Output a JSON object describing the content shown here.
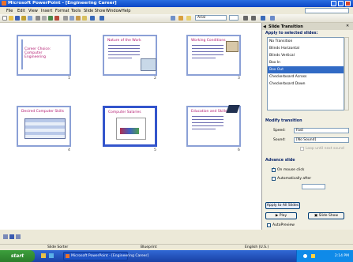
{
  "window": {
    "title": "Microsoft PowerPoint - [Engineering Career]"
  },
  "menu": [
    "File",
    "Edit",
    "View",
    "Insert",
    "Format",
    "Tools",
    "Slide Show",
    "Window",
    "Help"
  ],
  "toolbar": {
    "font_name": "Arial",
    "icons": [
      "new-icon",
      "open-icon",
      "save-icon",
      "permission-icon",
      "email-icon",
      "print-icon",
      "preview-icon",
      "spelling-icon",
      "research-icon",
      "cut-icon",
      "copy-icon",
      "paste-icon",
      "format-painter-icon",
      "undo-icon",
      "redo-icon"
    ]
  },
  "slides": [
    {
      "number": "1",
      "title": "Career Choice: Computer Engineering"
    },
    {
      "number": "2",
      "title": "Nature of the Work"
    },
    {
      "number": "3",
      "title": "Working Conditions"
    },
    {
      "number": "4",
      "title": "Desired Computer Skills"
    },
    {
      "number": "5",
      "title": "Computer Salaries"
    },
    {
      "number": "6",
      "title": "Education and Skills"
    }
  ],
  "task_pane": {
    "title": "Slide Transition",
    "apply_label": "Apply to selected slides:",
    "transitions": [
      "No Transition",
      "Blinds Horizontal",
      "Blinds Vertical",
      "Box In",
      "Box Out",
      "Checkerboard Across",
      "Checkerboard Down"
    ],
    "selected_transition": "Box Out",
    "modify_label": "Modify transition",
    "speed_label": "Speed:",
    "speed_value": "Fast",
    "sound_label": "Sound:",
    "sound_value": "[No Sound]",
    "loop_label": "Loop until next sound",
    "advance_label": "Advance slide",
    "on_click_label": "On mouse click",
    "auto_label": "Automatically after",
    "apply_all_button": "Apply to All Slides",
    "play_button": "Play",
    "slideshow_button": "Slide Show",
    "autopreview_label": "AutoPreview"
  },
  "statusbar": {
    "view": "Slide Sorter",
    "design": "Blueprint",
    "language": "English (U.S.)"
  },
  "taskbar": {
    "start": "start",
    "task": "Microsoft PowerPoint - [Engineering Career]",
    "clock": "2:14 PM"
  }
}
